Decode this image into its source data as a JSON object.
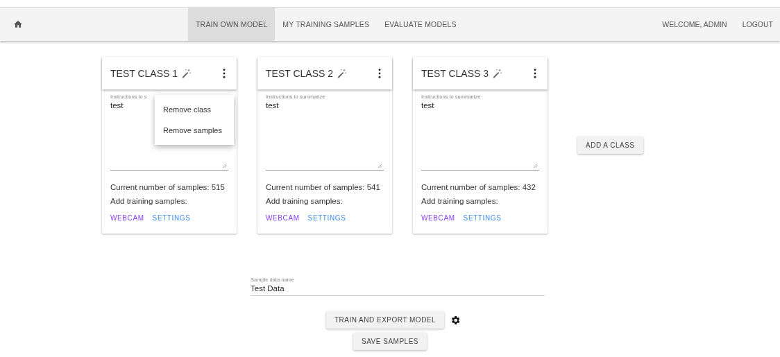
{
  "nav": {
    "tabs": [
      {
        "label": "TRAIN OWN MODEL",
        "selected": true
      },
      {
        "label": "MY TRAINING SAMPLES",
        "selected": false
      },
      {
        "label": "EVALUATE MODELS",
        "selected": false
      }
    ],
    "welcome": "WELCOME, ADMIN",
    "logout": "LOGOUT"
  },
  "classes": [
    {
      "title": "TEST CLASS 1",
      "label": "Instructions to s",
      "value": "test",
      "count": "Current number of samples: 515",
      "add": "Add training samples:",
      "links": [
        "WEBCAM",
        "SETTINGS"
      ],
      "menu": [
        "Remove class",
        "Remove samples"
      ]
    },
    {
      "title": "TEST CLASS 2",
      "label": "Instructions to summarize",
      "value": "test",
      "count": "Current number of samples: 541",
      "add": "Add training samples:",
      "links": [
        "WEBCAM",
        "SETTINGS"
      ]
    },
    {
      "title": "TEST CLASS 3",
      "label": "Instructions to summarize",
      "value": "test",
      "count": "Current number of samples: 432",
      "add": "Add training samples:",
      "links": [
        "WEBCAM",
        "SETTINGS"
      ]
    }
  ],
  "add_class": "ADD A CLASS",
  "sample_field": {
    "label": "Sample data name",
    "value": "Test Data"
  },
  "train_button": "TRAIN AND EXPORT MODEL",
  "save_button": "SAVE SAMPLES"
}
